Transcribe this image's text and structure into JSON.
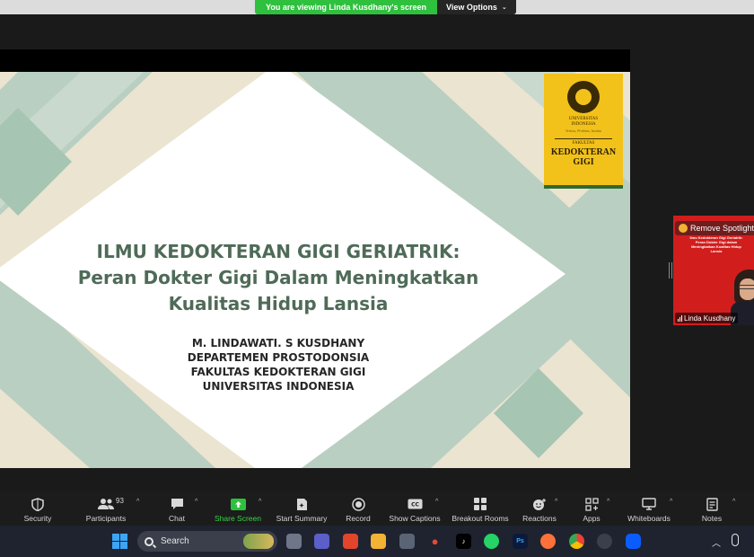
{
  "banner": {
    "viewing_text": "You are viewing Linda Kusdhany's screen",
    "view_options": "View Options"
  },
  "slide": {
    "title_lines": [
      "ILMU  KEDOKTERAN GIGI GERIATRIK:",
      "Peran Dokter Gigi Dalam Meningkatkan",
      "Kualitas Hidup Lansia"
    ],
    "author_lines": [
      "M. LINDAWATI. S KUSDHANY",
      "DEPARTEMEN PROSTODONSIA",
      "FAKULTAS KEDOKTERAN GIGI",
      "UNIVERSITAS INDONESIA"
    ],
    "badge": {
      "university": "UNIVERSITAS INDONESIA",
      "motto": "Veritas, Probitas, Iustitia",
      "faculty_label": "FAKULTAS",
      "department_line1": "KEDOKTERAN",
      "department_line2": "GIGI"
    },
    "colors": {
      "background": "#ebe4d0",
      "diamond_white": "#ffffff",
      "band_green": "#b9cfc1",
      "title_green": "#4f6b58",
      "badge_yellow": "#f3c21a"
    }
  },
  "spotlight": {
    "remove_label": "Remove Spotlight",
    "participant_name": "Linda Kusdhany",
    "inner_slide_text": "Ilmu Kedokteran Gigi Geriatrik: Peran Dokter Gigi dalam Meningkatkan Kualitas Hidup Lansia"
  },
  "toolbar": {
    "items": [
      {
        "label": "Security",
        "icon": "shield-icon"
      },
      {
        "label": "Participants",
        "icon": "participants-icon",
        "count": "93"
      },
      {
        "label": "Chat",
        "icon": "chat-icon"
      },
      {
        "label": "Share Screen",
        "icon": "share-screen-icon"
      },
      {
        "label": "Start Summary",
        "icon": "summary-icon"
      },
      {
        "label": "Record",
        "icon": "record-icon"
      },
      {
        "label": "Show Captions",
        "icon": "captions-icon"
      },
      {
        "label": "Breakout Rooms",
        "icon": "breakout-icon"
      },
      {
        "label": "Reactions",
        "icon": "reactions-icon"
      },
      {
        "label": "Apps",
        "icon": "apps-icon"
      },
      {
        "label": "Whiteboards",
        "icon": "whiteboard-icon"
      },
      {
        "label": "Notes",
        "icon": "notes-icon"
      }
    ]
  },
  "taskbar": {
    "search_label": "Search"
  }
}
